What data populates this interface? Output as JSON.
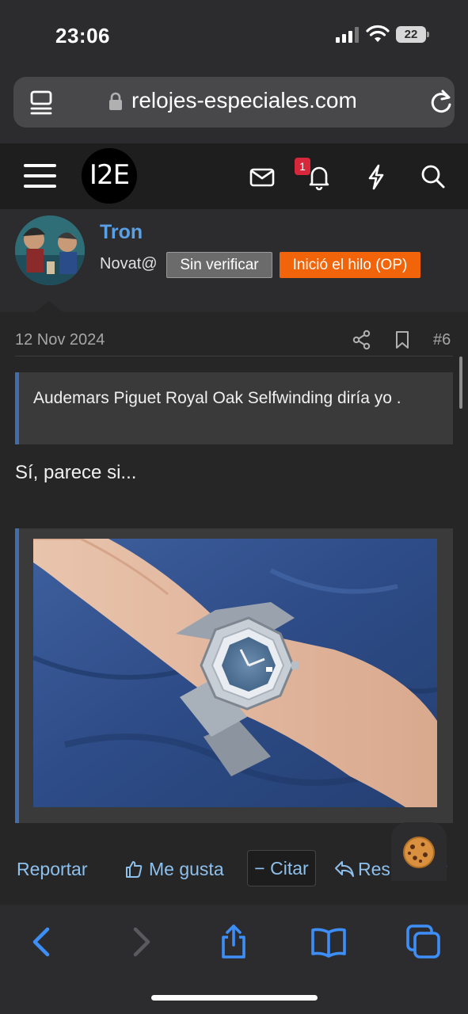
{
  "status_bar": {
    "time": "23:06",
    "battery": "22"
  },
  "browser": {
    "url": "relojes-especiales.com"
  },
  "site": {
    "logo_text": "I2E",
    "notification_count": "1"
  },
  "post": {
    "author": "Tron",
    "user_title": "Novat@",
    "badge_unverified": "Sin verificar",
    "badge_op": "Inició el hilo (OP)",
    "date": "12 Nov 2024",
    "post_number": "#6",
    "quote_text": "Audemars Piguet Royal Oak Selfwinding diría yo .",
    "body_text": "Sí, parece si..."
  },
  "actions": {
    "report": "Reportar",
    "like": "Me gusta",
    "quote": "Citar",
    "reply": "Responder"
  },
  "colors": {
    "accent_blue": "#5aa0e6",
    "link_blue": "#8ec0ee",
    "op_orange": "#f2640a",
    "notification_red": "#d7283b",
    "safari_blue": "#3e8ef7"
  },
  "icons": {
    "header": [
      "menu-icon",
      "mail-icon",
      "bell-icon",
      "lightning-icon",
      "search-icon"
    ],
    "toolbar": [
      "back-icon",
      "forward-icon",
      "share-icon",
      "bookmarks-icon",
      "tabs-icon"
    ]
  }
}
